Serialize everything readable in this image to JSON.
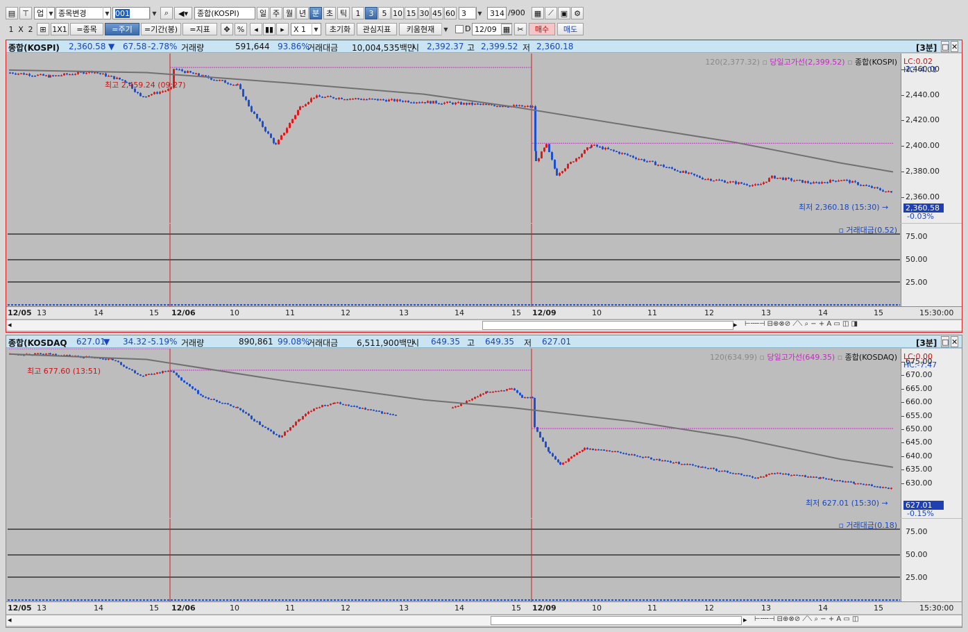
{
  "toolbar1": {
    "market": "업",
    "stock_change": "종목변경",
    "code": "001",
    "name": "종합(KOSPI)",
    "periods": [
      "일",
      "주",
      "월",
      "년",
      "분",
      "초",
      "틱"
    ],
    "intervals": [
      "1",
      "3",
      "5",
      "10",
      "15",
      "30",
      "45",
      "60"
    ],
    "interval_value": "3",
    "count": "314",
    "count_total": "/900"
  },
  "toolbar2": {
    "layout_1": "1",
    "layout_x": "X",
    "layout_2": "2",
    "one_by_one": "1X1",
    "stock_btn": "=종목",
    "period_btn": "=주기",
    "range_btn": "=기간(봉)",
    "indicator_btn": "=지표",
    "pct": "%",
    "zoom": "X 1",
    "reset": "초기화",
    "interest": "관심지표",
    "kiwoom": "키움현재",
    "date_check": "D",
    "date": "12/09",
    "buy": "매수",
    "sell": "매도"
  },
  "chart1": {
    "header": {
      "name": "종합(KOSPI)",
      "price": "2,360.58",
      "arrow": "▼",
      "change": "67.58",
      "rate": "-2.78%",
      "vol_label": "거래량",
      "volume": "591,644",
      "vol_pct": "93.86%",
      "amt_label": "거래대금",
      "amount": "10,004,535백만",
      "open_label": "시",
      "open": "2,392.37",
      "high_label": "고",
      "high": "2,399.52",
      "low_label": "저",
      "low": "2,360.18",
      "period": "[3분]"
    },
    "legend": {
      "ma": "120(2,377.32)",
      "high_line": "당일고가선(2,399.52)",
      "series": "종합(KOSPI)"
    },
    "lc": "LC:0.02",
    "hc": "HC:-4.01",
    "high_note": "최고 2,459.24 (09:27)",
    "low_note": "최저 2,360.18 (15:30)",
    "current": "2,360.58",
    "current_pct": "-0.03%",
    "yticks": [
      "2,460.00",
      "2,440.00",
      "2,420.00",
      "2,400.00",
      "2,380.00",
      "2,360.00"
    ],
    "sub_legend": "거래대금(0.52)",
    "sub_ticks": [
      "75.00",
      "50.00",
      "25.00"
    ],
    "xlabels": [
      "12/05",
      "13",
      "14",
      "15",
      "12/06",
      "10",
      "11",
      "12",
      "13",
      "14",
      "15",
      "12/09",
      "10",
      "11",
      "12",
      "13",
      "14",
      "15"
    ],
    "xtime": "15:30:00"
  },
  "chart2": {
    "header": {
      "name": "종합(KOSDAQ",
      "price": "627.01",
      "arrow": "▼",
      "change": "34.32",
      "rate": "-5.19%",
      "vol_label": "거래량",
      "volume": "890,861",
      "vol_pct": "99.08%",
      "amt_label": "거래대금",
      "amount": "6,511,900백만",
      "open_label": "시",
      "open": "649.35",
      "high_label": "고",
      "high": "649.35",
      "low_label": "저",
      "low": "627.01",
      "period": "[3분]"
    },
    "legend": {
      "ma": "120(634.99)",
      "high_line": "당일고가선(649.35)",
      "series": "종합(KOSDAQ)"
    },
    "lc": "LC:0.00",
    "hc": "HC:-7.47",
    "high_note": "최고 677.60 (13:51)",
    "low_note": "최저 627.01 (15:30)",
    "current": "627.01",
    "current_pct": "-0.15%",
    "yticks": [
      "675.00",
      "670.00",
      "665.00",
      "660.00",
      "655.00",
      "650.00",
      "645.00",
      "640.00",
      "635.00",
      "630.00"
    ],
    "sub_legend": "거래대금(0.18)",
    "sub_ticks": [
      "75.00",
      "50.00",
      "25.00"
    ],
    "xlabels": [
      "12/05",
      "13",
      "14",
      "15",
      "12/06",
      "10",
      "11",
      "12",
      "13",
      "14",
      "15",
      "12/09",
      "10",
      "11",
      "12",
      "13",
      "14",
      "15"
    ],
    "xtime": "15:30:00"
  },
  "colors": {
    "up": "#e01818",
    "down": "#1a4fd6",
    "ma": "#707070",
    "high_line": "#e020e0",
    "panel_bg": "#bdbdbd"
  }
}
